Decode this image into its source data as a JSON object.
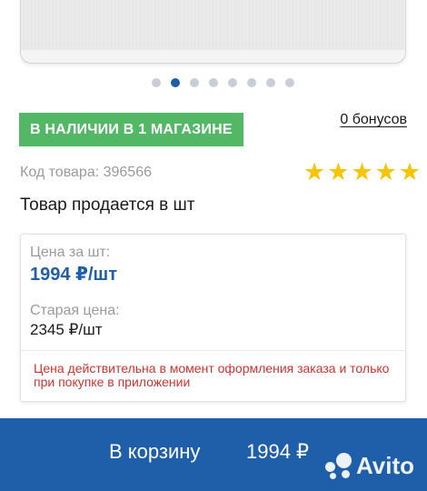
{
  "carousel": {
    "dot_count": 8,
    "active_index": 1
  },
  "stock_badge": "В НАЛИЧИИ В 1 МАГАЗИНЕ",
  "bonus_link": "0 бонусов",
  "sku": "Код товара: 396566",
  "rating": {
    "stars": 5,
    "max": 5,
    "color": "#f6c400"
  },
  "unit_note": "Товар продается в шт",
  "price_box": {
    "price_label": "Цена за шт:",
    "price_value": "1994 ₽/шт",
    "old_label": "Старая цена:",
    "old_value": "2345 ₽/шт",
    "notice": "Цена действительна в момент оформления заказа и только при покупке в приложении"
  },
  "cart": {
    "label": "В корзину",
    "price": "1994 ₽"
  },
  "watermark": "Avito",
  "colors": {
    "accent": "#1f5ea8",
    "stock": "#53b865",
    "notice": "#d0332d"
  }
}
